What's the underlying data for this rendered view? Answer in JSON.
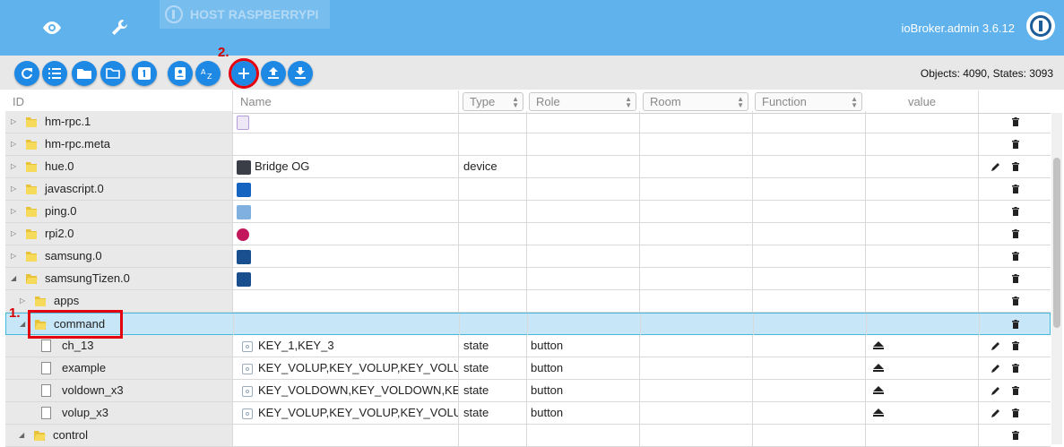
{
  "header": {
    "host_tab": "HOST RASPBERRYPI",
    "app_title": "ioBroker.admin 3.6.12",
    "icons": [
      "eye-icon",
      "wrench-icon"
    ],
    "accent": "#5fb2ec"
  },
  "toolbar": {
    "buttons": [
      "refresh-icon",
      "list-icon",
      "folder-icon",
      "folder-open-icon",
      "number-1-icon",
      "contact-icon",
      "sort-az-icon",
      "add-icon",
      "upload-icon",
      "download-icon"
    ],
    "step2": "2.",
    "stats": "Objects: 4090, States: 3093"
  },
  "step1": "1.",
  "columns": {
    "id": "ID",
    "name": "Name",
    "type": "Type",
    "role": "Role",
    "room": "Room",
    "function": "Function",
    "value": "value"
  },
  "rows": [
    {
      "id": "hm-rpc.1",
      "name": "",
      "type": "",
      "role": ""
    },
    {
      "id": "hm-rpc.meta",
      "name": "",
      "type": "",
      "role": ""
    },
    {
      "id": "hue.0",
      "name": "Bridge OG",
      "type": "device",
      "role": ""
    },
    {
      "id": "javascript.0",
      "name": "",
      "type": "",
      "role": ""
    },
    {
      "id": "ping.0",
      "name": "",
      "type": "",
      "role": ""
    },
    {
      "id": "rpi2.0",
      "name": "",
      "type": "",
      "role": ""
    },
    {
      "id": "samsung.0",
      "name": "",
      "type": "",
      "role": ""
    },
    {
      "id": "samsungTizen.0",
      "name": "",
      "type": "",
      "role": ""
    },
    {
      "id": "apps",
      "name": "",
      "type": "",
      "role": ""
    },
    {
      "id": "command",
      "name": "",
      "type": "",
      "role": ""
    },
    {
      "id": "ch_13",
      "name": "KEY_1,KEY_3",
      "type": "state",
      "role": "button"
    },
    {
      "id": "example",
      "name": "KEY_VOLUP,KEY_VOLUP,KEY_VOLUP,...",
      "type": "state",
      "role": "button"
    },
    {
      "id": "voldown_x3",
      "name": "KEY_VOLDOWN,KEY_VOLDOWN,KE...",
      "type": "state",
      "role": "button"
    },
    {
      "id": "volup_x3",
      "name": "KEY_VOLUP,KEY_VOLUP,KEY_VOLUP",
      "type": "state",
      "role": "button"
    },
    {
      "id": "control",
      "name": "",
      "type": "",
      "role": ""
    }
  ]
}
